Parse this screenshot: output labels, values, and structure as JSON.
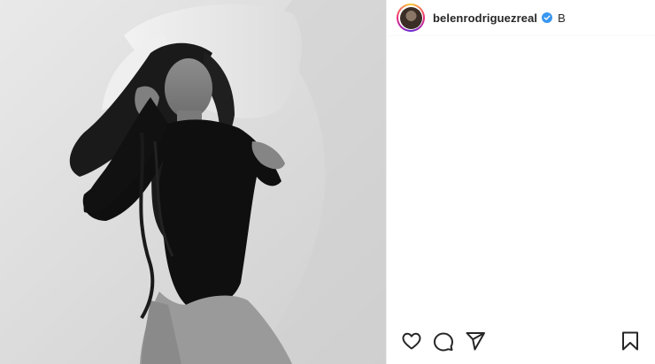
{
  "post": {
    "author": {
      "username": "belenrodriguezreal",
      "verified": true,
      "follow_label": "B"
    },
    "photo": {
      "description": "Black and white portrait"
    },
    "actions": {
      "icons": [
        "heart-icon",
        "comment-icon",
        "share-icon",
        "bookmark-icon"
      ]
    }
  },
  "colors": {
    "text": "#262626",
    "verified_badge": "#3897f0",
    "background": "#ffffff"
  }
}
